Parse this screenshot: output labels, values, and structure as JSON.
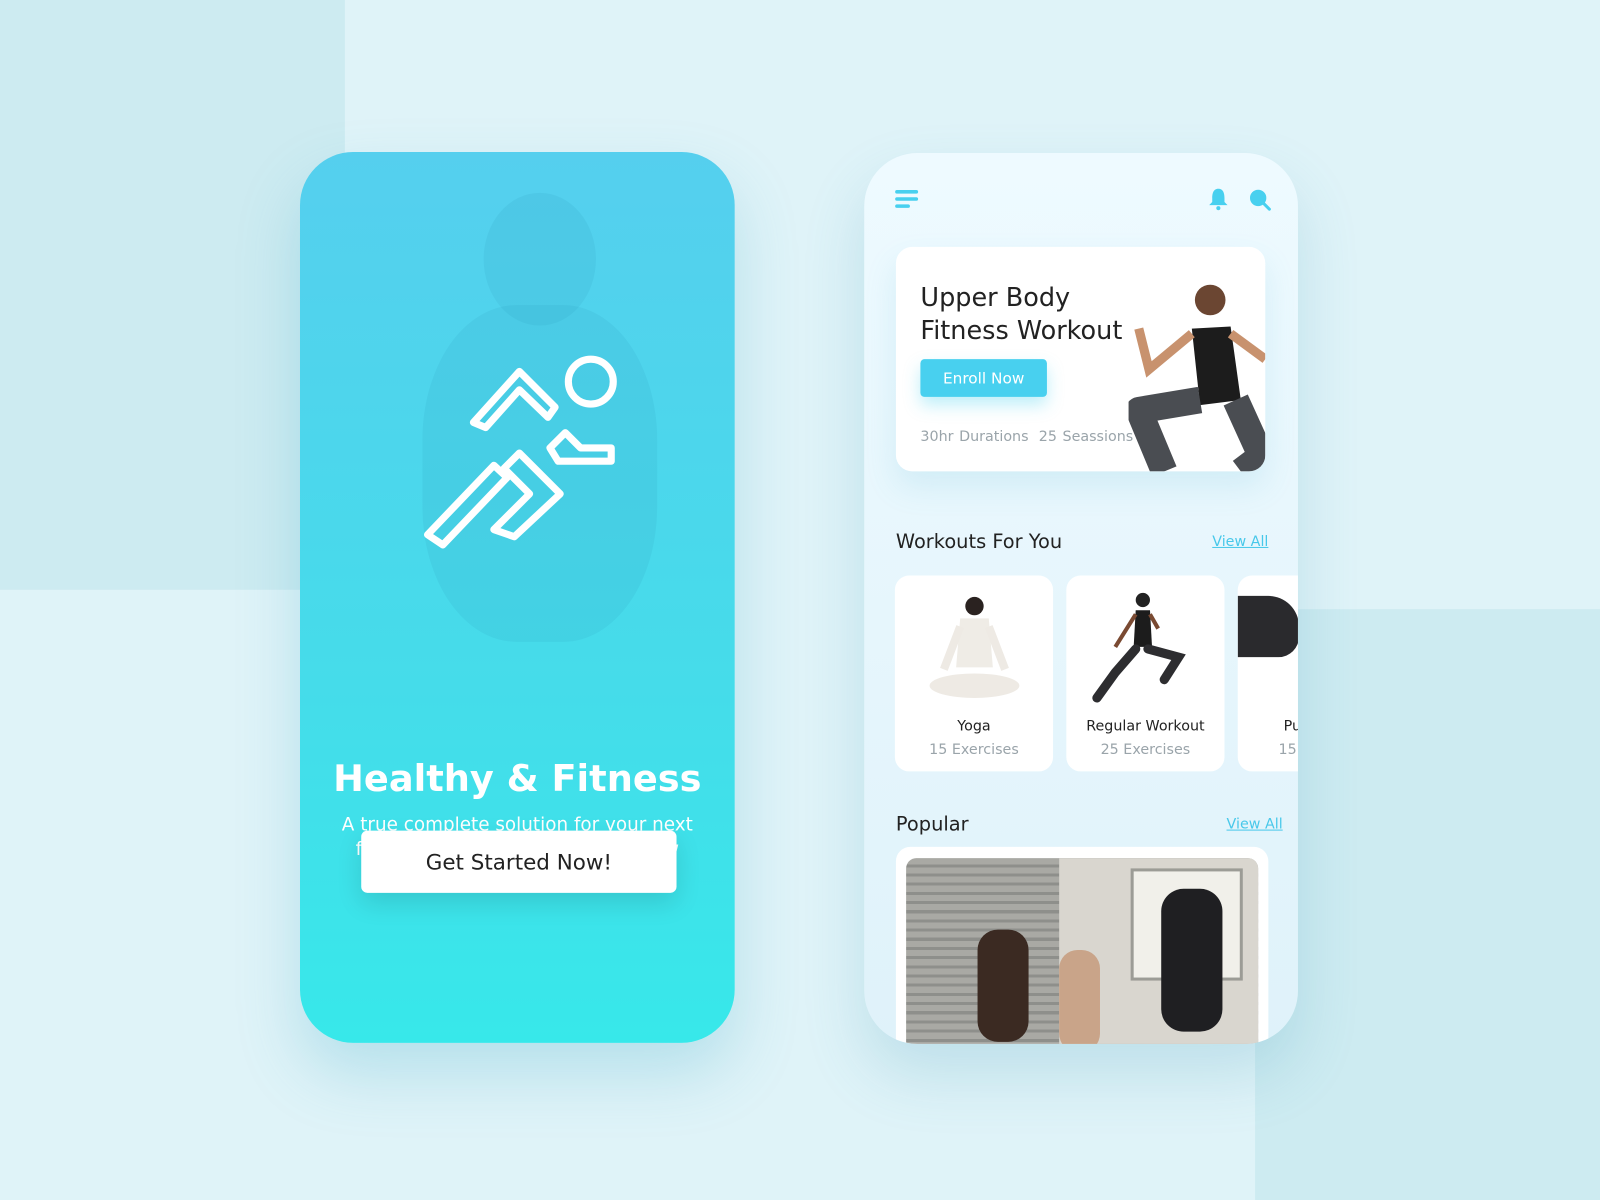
{
  "colors": {
    "accent": "#48d0ef",
    "background": "#dff3f8",
    "gradient_top": "#55cfee",
    "gradient_bottom": "#37e8ea"
  },
  "splash": {
    "icon": "running-person-icon",
    "title": "Healthy & Fitness",
    "subtitle": "A true complete solution for your next fitness app UI projects. Grab it now",
    "cta": "Get Started Now!"
  },
  "home": {
    "header": {
      "menu_icon": "hamburger-menu-icon",
      "bell_icon": "bell-icon",
      "search_icon": "search-icon"
    },
    "hero": {
      "title_line1": "Upper Body",
      "title_line2": "Fitness Workout",
      "button": "Enroll Now",
      "duration": "30hr Durations",
      "sessions": "25 Seassions"
    },
    "workouts": {
      "title": "Workouts For You",
      "view_all": "View All",
      "items": [
        {
          "name": "Yoga",
          "count": "15 Exercises"
        },
        {
          "name": "Regular Workout",
          "count": "25 Exercises"
        },
        {
          "name": "Pu",
          "count": "15"
        }
      ]
    },
    "popular": {
      "title": "Popular",
      "view_all": "View All"
    }
  }
}
